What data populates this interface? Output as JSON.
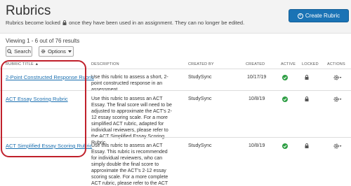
{
  "header": {
    "title": "Rubrics",
    "subtitle_before": "Rubrics become locked",
    "subtitle_after": "once they have been used in an assignment. They can no longer be edited.",
    "create_label": "Create Rubric"
  },
  "viewing_text": "Viewing 1 - 6 out of 76 results",
  "toolbar": {
    "search_label": "Search",
    "options_label": "Options"
  },
  "columns": {
    "title": "RUBRIC TITLE",
    "description": "DESCRIPTION",
    "created_by": "CREATED BY",
    "created": "CREATED",
    "active": "ACTIVE",
    "locked": "LOCKED",
    "actions": "ACTIONS"
  },
  "rows": [
    {
      "title": "2-Point Constructed Response Rubric",
      "description": "Use this rubric to assess a short, 2-point constructed response in an assessment.",
      "created_by": "StudySync",
      "created": "10/17/19"
    },
    {
      "title": "ACT Essay Scoring Rubric",
      "description": "Use this rubric to assess an ACT Essay. The final score will need to be adjusted to approximate the ACT's 2-12 essay scoring scale. For a more simplified ACT rubric, adapted for individual reviewers, please refer to the ACT Simplified Essay Scoring Rubric.",
      "created_by": "StudySync",
      "created": "10/8/19"
    },
    {
      "title": "ACT Simplified Essay Scoring Rubric",
      "description": "Use this rubric to assess an ACT Essay. This rubric is recommended for individual reviewers, who can simply double the final score to approximate the ACT's 2-12 essay scoring scale. For a more complete ACT rubric, please refer to the ACT Essay Scoring Rubric.",
      "created_by": "StudySync",
      "created": "10/8/19"
    }
  ],
  "colors": {
    "accent": "#1a73b5",
    "link": "#1a6fb0",
    "active_check": "#2e9e44",
    "highlight": "#c0202b"
  },
  "icons": {
    "lock": "lock-icon",
    "check": "check-circle-icon",
    "gear": "gear-icon",
    "chevron": "chevron-down-icon",
    "sort": "sort-up-icon"
  }
}
